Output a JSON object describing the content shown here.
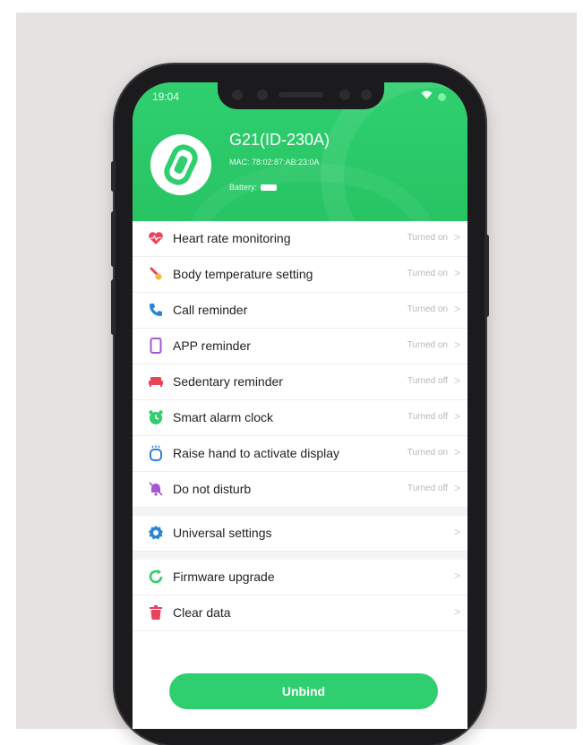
{
  "status_bar": {
    "time": "19:04",
    "indicators": "wifi-icon battery-icon"
  },
  "device": {
    "name": "G21(ID-230A)",
    "mac": "MAC: 78:02:87:AB:23:0A",
    "battery_label": "Battery:"
  },
  "settings_group_1": [
    {
      "label": "Heart rate monitoring",
      "status": "Turned on",
      "icon": "heart-icon",
      "color": "#e9435a"
    },
    {
      "label": "Body temperature setting",
      "status": "Turned on",
      "icon": "thermometer-icon",
      "color": "#e9435a"
    },
    {
      "label": "Call reminder",
      "status": "Turned on",
      "icon": "phone-icon",
      "color": "#2a84d6"
    },
    {
      "label": "APP reminder",
      "status": "Turned on",
      "icon": "smartphone-icon",
      "color": "#a457d6"
    },
    {
      "label": "Sedentary reminder",
      "status": "Turned off",
      "icon": "sofa-icon",
      "color": "#e9435a"
    },
    {
      "label": "Smart alarm clock",
      "status": "Turned off",
      "icon": "alarm-clock-icon",
      "color": "#2fcf6f"
    },
    {
      "label": "Raise hand to activate display",
      "status": "Turned on",
      "icon": "raise-hand-icon",
      "color": "#2a84d6"
    },
    {
      "label": "Do not disturb",
      "status": "Turned off",
      "icon": "bell-off-icon",
      "color": "#a457d6"
    }
  ],
  "settings_group_2": [
    {
      "label": "Universal settings",
      "icon": "gear-icon",
      "color": "#2a84d6"
    }
  ],
  "settings_group_3": [
    {
      "label": "Firmware upgrade",
      "icon": "refresh-icon",
      "color": "#2fcf6f"
    },
    {
      "label": "Clear data",
      "icon": "trash-icon",
      "color": "#e9435a"
    }
  ],
  "chevron": ">",
  "unbind_label": "Unbind",
  "colors": {
    "accent": "#2fcf6f",
    "text": "#222222",
    "muted": "#b8b8b8"
  }
}
